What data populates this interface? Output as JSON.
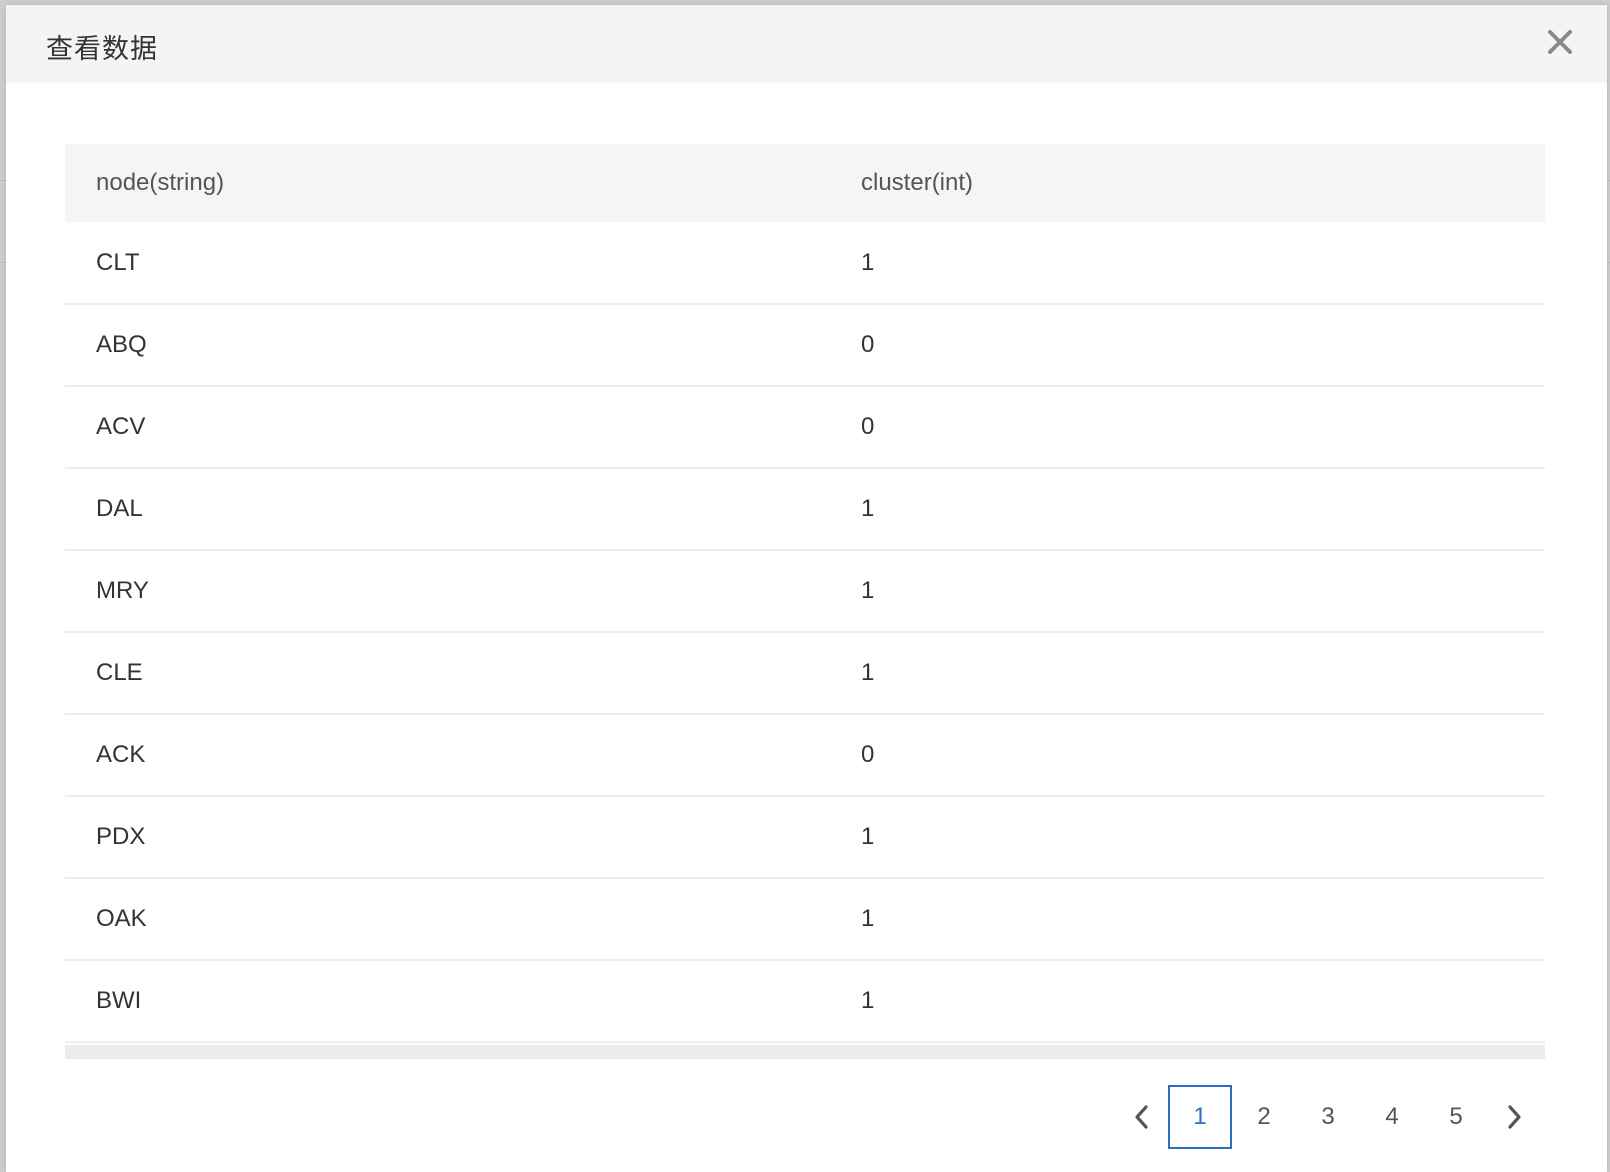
{
  "modal": {
    "title": "查看数据",
    "close_label": "×"
  },
  "table": {
    "columns": [
      "node(string)",
      "cluster(int)"
    ],
    "rows": [
      [
        "CLT",
        "1"
      ],
      [
        "ABQ",
        "0"
      ],
      [
        "ACV",
        "0"
      ],
      [
        "DAL",
        "1"
      ],
      [
        "MRY",
        "1"
      ],
      [
        "CLE",
        "1"
      ],
      [
        "ACK",
        "0"
      ],
      [
        "PDX",
        "1"
      ],
      [
        "OAK",
        "1"
      ],
      [
        "BWI",
        "1"
      ]
    ]
  },
  "pagination": {
    "pages": [
      "1",
      "2",
      "3",
      "4",
      "5"
    ],
    "current": "1"
  },
  "colors": {
    "accent": "#2a6ec6",
    "header_bg": "#f4f4f4"
  }
}
